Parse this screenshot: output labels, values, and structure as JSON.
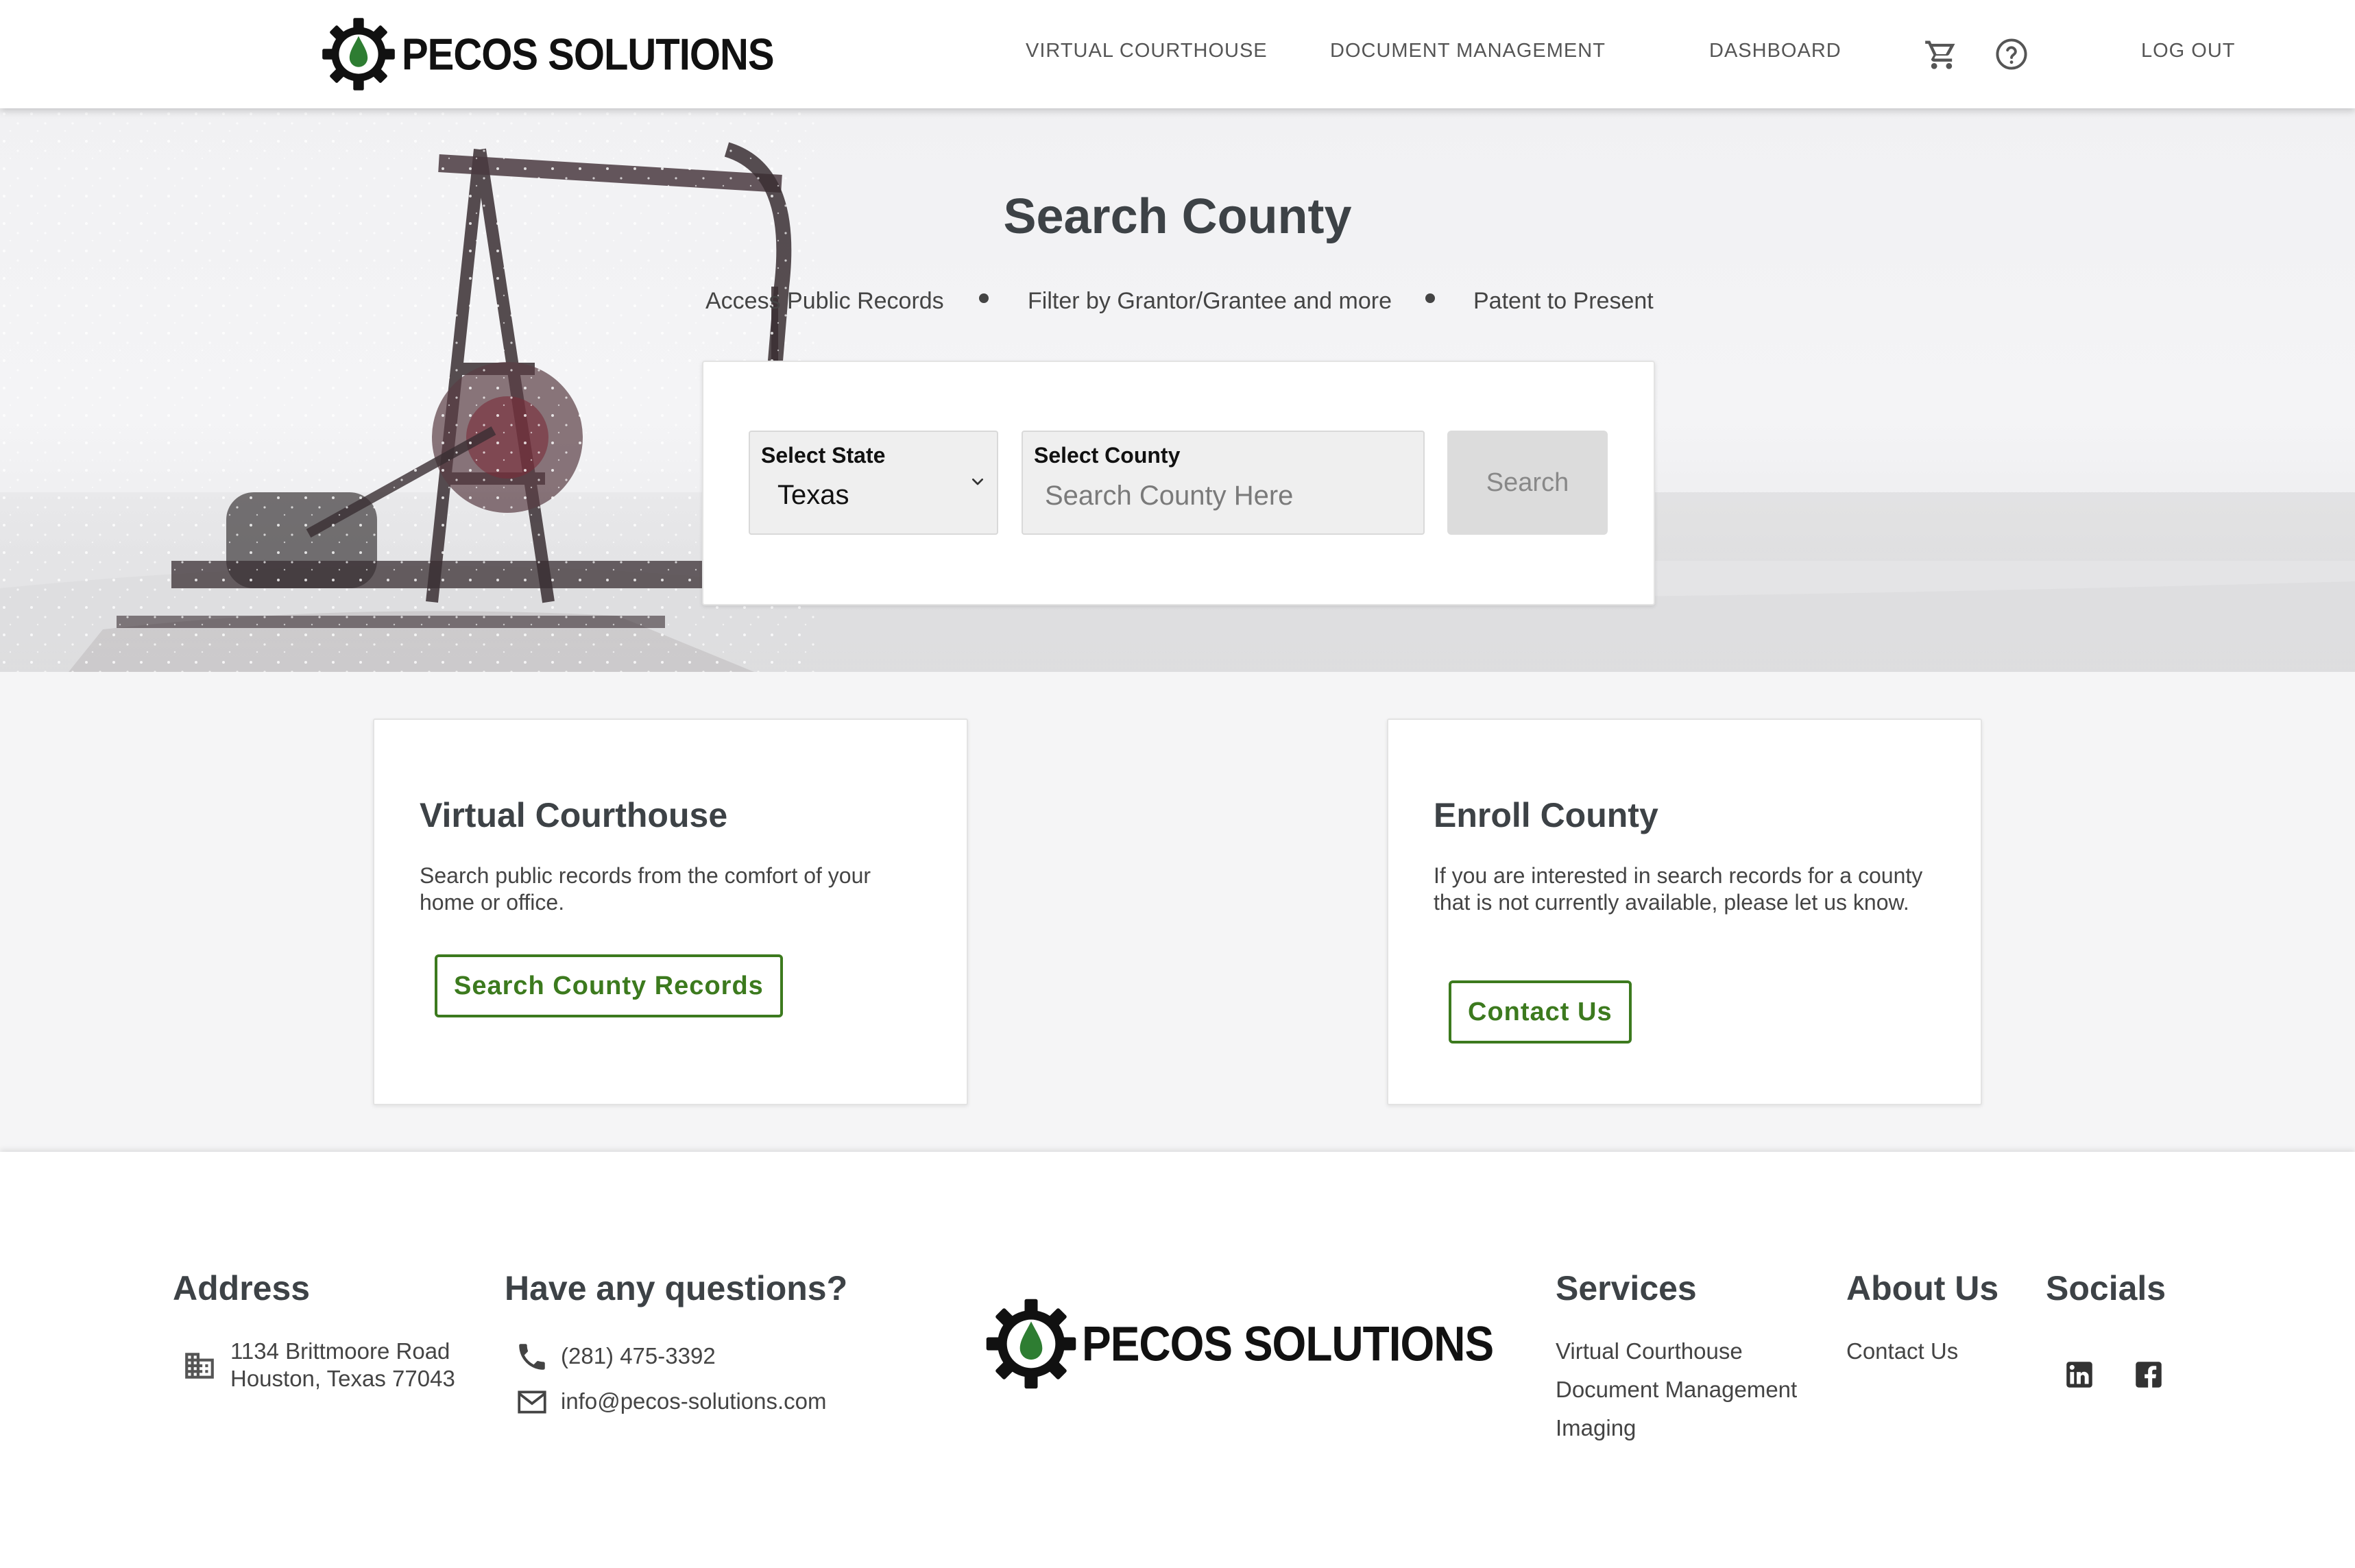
{
  "nav": {
    "brand": "PECOS SOLUTIONS",
    "links": [
      "VIRTUAL COURTHOUSE",
      "DOCUMENT MANAGEMENT",
      "DASHBOARD",
      "LOG OUT"
    ],
    "icons": [
      "shopping-cart-icon",
      "help-circle-icon"
    ]
  },
  "hero": {
    "title": "Search County",
    "taglines": [
      "Access Public Records",
      "Filter by Grantor/Grantee and more",
      "Patent to Present"
    ],
    "state_label": "Select State",
    "state_value": "Texas",
    "county_label": "Select County",
    "county_placeholder": "Search County Here",
    "search_button": "Search"
  },
  "cards": [
    {
      "title": "Virtual Courthouse",
      "text": "Search public records from the comfort of your home or office.",
      "button": "Search County Records"
    },
    {
      "title": "Enroll County",
      "text": "If you are interested in search records for a county that is not currently available, please let us know.",
      "button": "Contact Us"
    }
  ],
  "footer": {
    "address_heading": "Address",
    "address_line1": "1134 Brittmoore Road",
    "address_line2": "Houston, Texas 77043",
    "questions_heading": "Have any questions?",
    "phone": "(281) 475-3392",
    "email": "info@pecos-solutions.com",
    "brand": "PECOS SOLUTIONS",
    "services_heading": "Services",
    "services": [
      "Virtual Courthouse",
      "Document Management",
      "Imaging"
    ],
    "about_heading": "About Us",
    "about": [
      "Contact Us"
    ],
    "socials_heading": "Socials",
    "socials": [
      "linkedin-icon",
      "facebook-icon"
    ]
  },
  "colors": {
    "accent_green": "#3c7a1e",
    "heading_gray": "#3d4246",
    "logo_drop_green": "#2e7d32"
  }
}
